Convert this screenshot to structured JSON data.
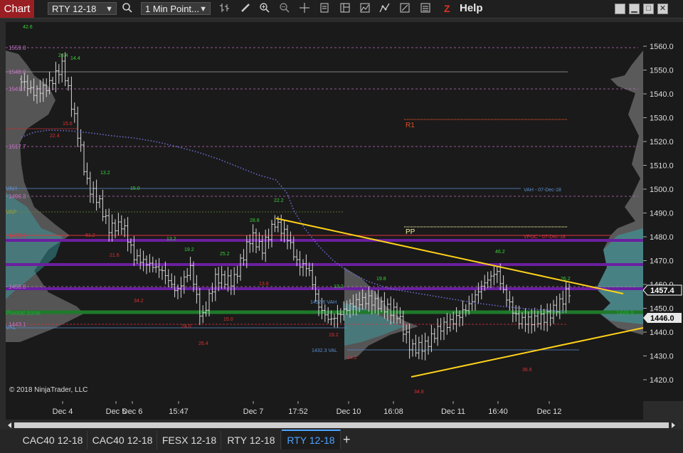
{
  "toolbar": {
    "window_title": "Chart",
    "instrument": "RTY 12-18",
    "interval": "1 Min Point...",
    "help_label": "Help",
    "icons": [
      "search-icon",
      "bar-type-icon",
      "pencil-icon",
      "zoom-in-icon",
      "zoom-out-icon",
      "crosshair-icon",
      "data-box-icon",
      "templates-icon",
      "indicators-icon",
      "strategies-icon",
      "properties-icon",
      "snapshot-icon",
      "zoom-z-icon"
    ]
  },
  "chart": {
    "copyright": "© 2018 NinjaTrader, LLC",
    "price_ticks": [
      "1560.0",
      "1550.0",
      "1540.0",
      "1530.0",
      "1520.0",
      "1510.0",
      "1500.0",
      "1490.0",
      "1480.0",
      "1470.0",
      "1460.0",
      "1450.0",
      "1440.0",
      "1430.0",
      "1420.0"
    ],
    "last_price": "1457.4",
    "pivot_price": "1446.0",
    "time_ticks": [
      "Dec 4",
      "Dec 5",
      "Dec 6",
      "15:47",
      "Dec 7",
      "17:52",
      "Dec 10",
      "16:08",
      "Dec 11",
      "16:40",
      "Dec 12"
    ],
    "pivot_labels": {
      "r1": "R1",
      "pp": "PP"
    },
    "left_labels": [
      "1559.0",
      "1548.8",
      "1541.7",
      "1517.7",
      "VAH",
      "1496.3",
      "VAP",
      "1480.0",
      "1458.8",
      "Pivotal zone",
      "VAL",
      "1443.1"
    ],
    "annotations": {
      "vah_note": "VAH - 07-Dec-18",
      "vpoc_note": "VPOC - 07-Dec-18",
      "vah_mid": "1452.6 VAH",
      "val_mid": "1432.3 VAL",
      "pivot_right": "1448.9"
    },
    "high_counts": [
      "42.6",
      "20.4",
      "14.4",
      "13.2",
      "15.0",
      "13.2",
      "19.2",
      "25.2",
      "28.8",
      "22.2",
      "13.2",
      "19.8",
      "46.2",
      "26.2"
    ],
    "low_counts": [
      "22.4",
      "15.6",
      "61.2",
      "21.6",
      "34.2",
      "24.0",
      "26.4",
      "15.0",
      "13.8",
      "34.8",
      "36.6",
      "19.2",
      "14.2"
    ]
  },
  "bottom_tabs": [
    "CAC40 12-18",
    "CAC40 12-18",
    "FESX 12-18",
    "RTY 12-18",
    "RTY 12-18"
  ],
  "active_tab_index": 4,
  "colors": {
    "title_red": "#9a1f23",
    "trendline": "#ffd21a",
    "price_bar": "#d8d8d8",
    "vwap_dotted": "#6a6ad0",
    "pivot_green": "#1f7a2a",
    "value_area_purple": "#6b1fa0",
    "active_tab": "#4da3ff"
  }
}
